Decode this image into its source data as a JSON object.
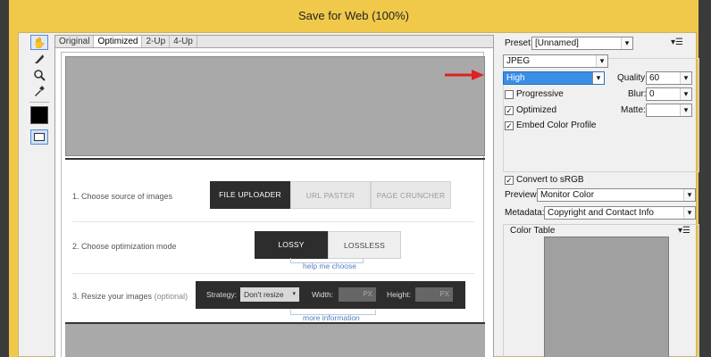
{
  "window": {
    "title": "Save for Web (100%)"
  },
  "tools": [
    "hand-icon",
    "slice-select-icon",
    "zoom-icon",
    "eyedropper-icon"
  ],
  "tabs": [
    "Original",
    "Optimized",
    "2-Up",
    "4-Up"
  ],
  "selected_tab": "Optimized",
  "page": {
    "step1": {
      "label": "1. Choose source of images",
      "buttons": [
        "FILE UPLOADER",
        "URL PASTER",
        "PAGE CRUNCHER"
      ]
    },
    "step2": {
      "label": "2. Choose optimization mode",
      "buttons": [
        "LOSSY",
        "LOSSLESS"
      ],
      "help": "help me choose"
    },
    "step3": {
      "label": "3. Resize your images",
      "optional": "(optional)",
      "strategy_label": "Strategy:",
      "strategy_value": "Don't resize",
      "width_label": "Width:",
      "height_label": "Height:",
      "px": "PX",
      "help": "more information"
    }
  },
  "settings": {
    "preset_label": "Preset:",
    "preset_value": "[Unnamed]",
    "format_value": "JPEG",
    "quality_preset": "High",
    "quality_label": "Quality:",
    "quality_value": "60",
    "progressive_label": "Progressive",
    "blur_label": "Blur:",
    "blur_value": "0",
    "optimized_label": "Optimized",
    "matte_label": "Matte:",
    "embed_label": "Embed Color Profile",
    "convert_label": "Convert to sRGB",
    "preview_label": "Preview:",
    "preview_value": "Monitor Color",
    "metadata_label": "Metadata:",
    "metadata_value": "Copyright and Contact Info",
    "color_table_label": "Color Table"
  },
  "colors": {
    "highlight": "#3a8ee6",
    "arrow": "#e02020",
    "titlebar": "#f1c94a"
  }
}
